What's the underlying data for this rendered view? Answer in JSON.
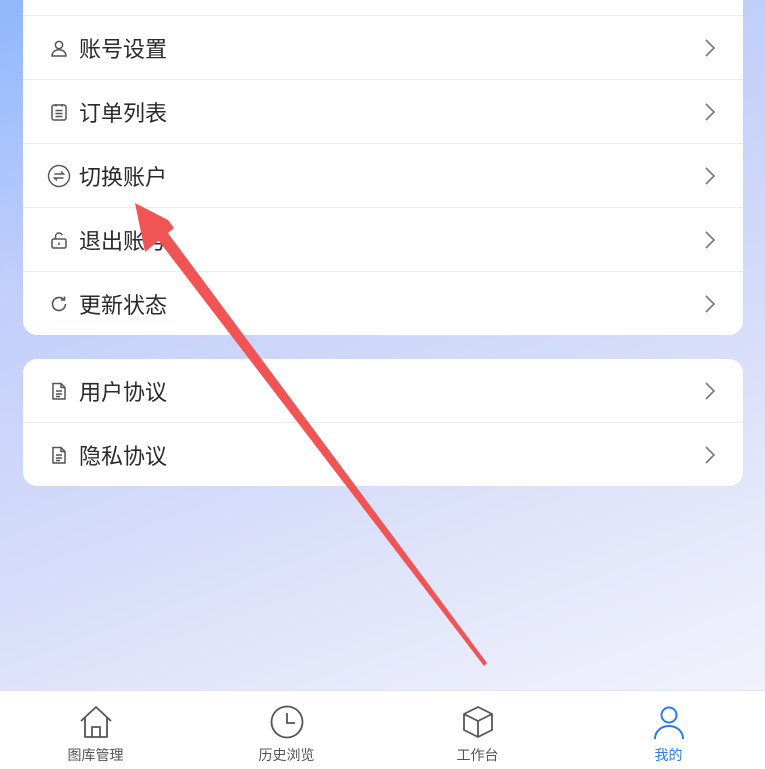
{
  "menu_group_1": {
    "items": [
      {
        "label": "账号设置",
        "icon": "user-icon"
      },
      {
        "label": "订单列表",
        "icon": "list-icon"
      },
      {
        "label": "切换账户",
        "icon": "switch-icon"
      },
      {
        "label": "退出账号",
        "icon": "unlock-icon"
      },
      {
        "label": "更新状态",
        "icon": "refresh-icon"
      }
    ]
  },
  "menu_group_2": {
    "items": [
      {
        "label": "用户协议",
        "icon": "document-icon"
      },
      {
        "label": "隐私协议",
        "icon": "document-icon"
      }
    ]
  },
  "tabbar": {
    "tabs": [
      {
        "label": "图库管理",
        "icon": "home-icon"
      },
      {
        "label": "历史浏览",
        "icon": "clock-icon"
      },
      {
        "label": "工作台",
        "icon": "cube-icon"
      },
      {
        "label": "我的",
        "icon": "person-icon",
        "active": true
      }
    ]
  },
  "colors": {
    "accent": "#2b7ae6",
    "annotation_arrow": "#f05454",
    "label_text": "#2a2a2a"
  }
}
